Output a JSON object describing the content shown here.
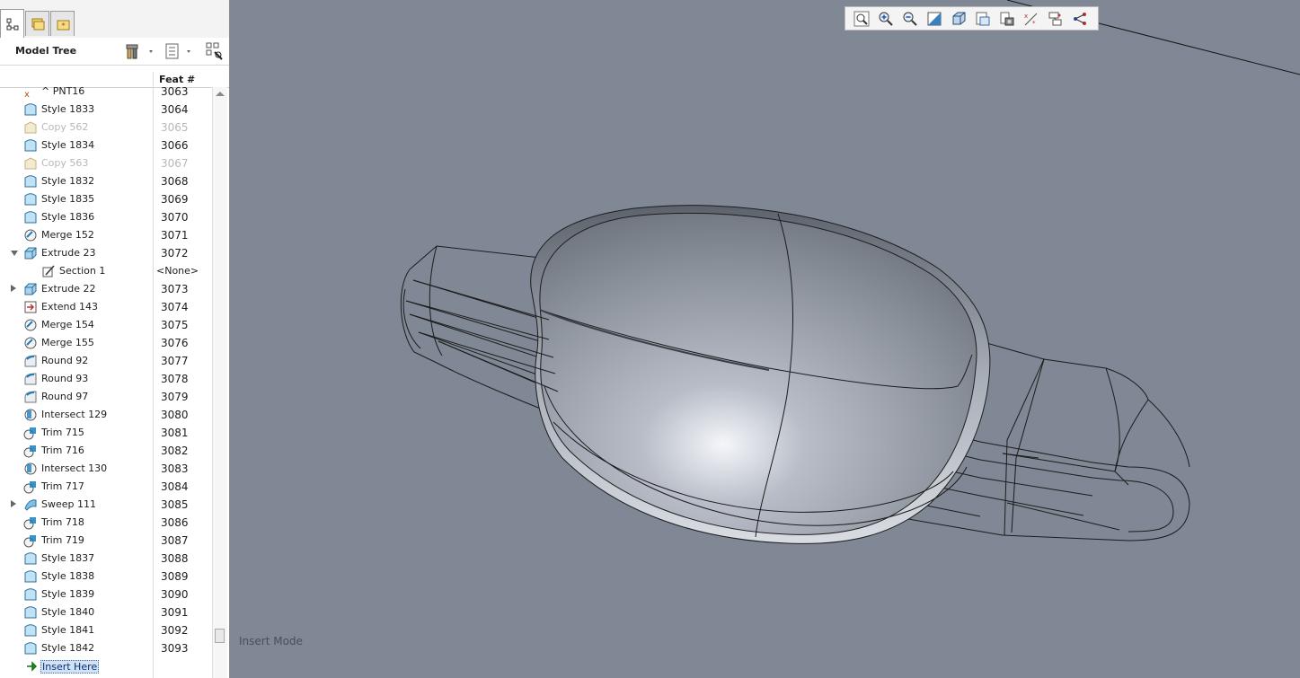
{
  "tabs": [
    "model-tree-tab",
    "folder-browser-tab",
    "favorites-tab"
  ],
  "header": {
    "title": "Model Tree"
  },
  "columns": {
    "feat": "Feat #"
  },
  "rows": [
    {
      "name": "^ PNT16",
      "feat": "3063",
      "icon": "datum-point-icon",
      "suppressed": false
    },
    {
      "name": "Style 1833",
      "feat": "3064",
      "icon": "style-icon",
      "suppressed": false
    },
    {
      "name": "Copy 562",
      "feat": "3065",
      "icon": "copy-icon",
      "suppressed": true
    },
    {
      "name": "Style 1834",
      "feat": "3066",
      "icon": "style-icon",
      "suppressed": false
    },
    {
      "name": "Copy 563",
      "feat": "3067",
      "icon": "copy-icon",
      "suppressed": true
    },
    {
      "name": "Style 1832",
      "feat": "3068",
      "icon": "style-icon",
      "suppressed": false
    },
    {
      "name": "Style 1835",
      "feat": "3069",
      "icon": "style-icon",
      "suppressed": false
    },
    {
      "name": "Style 1836",
      "feat": "3070",
      "icon": "style-icon",
      "suppressed": false
    },
    {
      "name": "Merge 152",
      "feat": "3071",
      "icon": "merge-icon",
      "suppressed": false
    },
    {
      "name": "Extrude 23",
      "feat": "3072",
      "icon": "extrude-icon",
      "suppressed": false,
      "expand": "down"
    },
    {
      "name": "Section 1",
      "feat": "<None>",
      "icon": "sketch-icon",
      "suppressed": false,
      "sub": true
    },
    {
      "name": "Extrude 22",
      "feat": "3073",
      "icon": "extrude-icon",
      "suppressed": false,
      "expand": "right"
    },
    {
      "name": "Extend 143",
      "feat": "3074",
      "icon": "extend-icon",
      "suppressed": false
    },
    {
      "name": "Merge 154",
      "feat": "3075",
      "icon": "merge-icon",
      "suppressed": false
    },
    {
      "name": "Merge 155",
      "feat": "3076",
      "icon": "merge-icon",
      "suppressed": false
    },
    {
      "name": "Round 92",
      "feat": "3077",
      "icon": "round-icon",
      "suppressed": false
    },
    {
      "name": "Round 93",
      "feat": "3078",
      "icon": "round-icon",
      "suppressed": false
    },
    {
      "name": "Round 97",
      "feat": "3079",
      "icon": "round-icon",
      "suppressed": false
    },
    {
      "name": "Intersect 129",
      "feat": "3080",
      "icon": "intersect-icon",
      "suppressed": false
    },
    {
      "name": "Trim 715",
      "feat": "3081",
      "icon": "trim-icon",
      "suppressed": false
    },
    {
      "name": "Trim 716",
      "feat": "3082",
      "icon": "trim-icon",
      "suppressed": false
    },
    {
      "name": "Intersect 130",
      "feat": "3083",
      "icon": "intersect-icon",
      "suppressed": false
    },
    {
      "name": "Trim 717",
      "feat": "3084",
      "icon": "trim-icon",
      "suppressed": false
    },
    {
      "name": "Sweep 111",
      "feat": "3085",
      "icon": "sweep-icon",
      "suppressed": false,
      "expand": "right"
    },
    {
      "name": "Trim 718",
      "feat": "3086",
      "icon": "trim-icon",
      "suppressed": false
    },
    {
      "name": "Trim 719",
      "feat": "3087",
      "icon": "trim-icon",
      "suppressed": false
    },
    {
      "name": "Style 1837",
      "feat": "3088",
      "icon": "style-icon",
      "suppressed": false
    },
    {
      "name": "Style 1838",
      "feat": "3089",
      "icon": "style-icon",
      "suppressed": false
    },
    {
      "name": "Style 1839",
      "feat": "3090",
      "icon": "style-icon",
      "suppressed": false
    },
    {
      "name": "Style 1840",
      "feat": "3091",
      "icon": "style-icon",
      "suppressed": false
    },
    {
      "name": "Style 1841",
      "feat": "3092",
      "icon": "style-icon",
      "suppressed": false
    },
    {
      "name": "Style 1842",
      "feat": "3093",
      "icon": "style-icon",
      "suppressed": false
    }
  ],
  "insert": {
    "label": "Insert Here"
  },
  "toolbar": [
    "zoom-fit-icon",
    "zoom-in-icon",
    "zoom-out-icon",
    "repaint-icon",
    "display-style-icon",
    "saved-views-icon",
    "view-manager-icon",
    "datum-display-icon",
    "spin-center-icon",
    "annotation-icon"
  ],
  "viewport": {
    "mode": "Insert Mode"
  },
  "colors": {
    "viewport_bg": "#7f8894",
    "selection": "#cfe2f7"
  }
}
